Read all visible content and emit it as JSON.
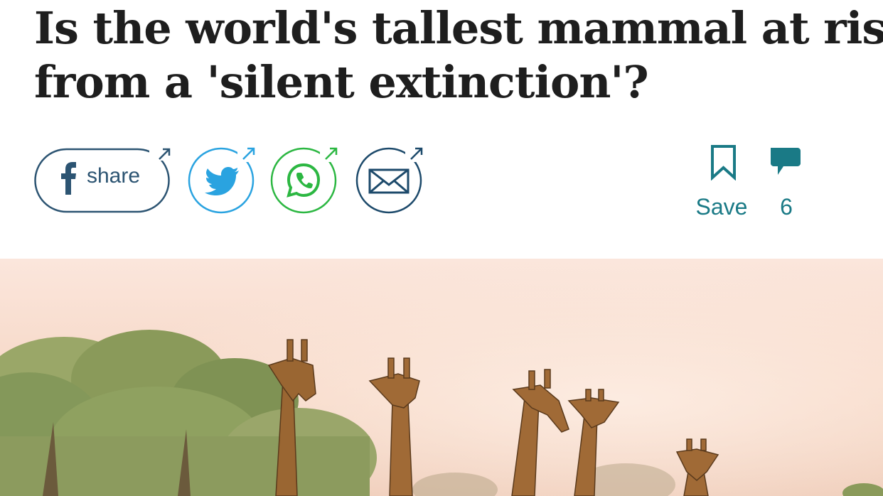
{
  "article": {
    "headline_line1": "Is the world's tallest mammal at risk",
    "headline_line2": "from a 'silent extinction'?"
  },
  "share": {
    "facebook_label": "share",
    "buttons": [
      "facebook",
      "twitter",
      "whatsapp",
      "email"
    ]
  },
  "actions": {
    "save_label": "Save",
    "comment_count": "6"
  },
  "hero_image": {
    "subject": "giraffes at dusk",
    "giraffe_count": 5
  },
  "colors": {
    "headline": "#1e1e1e",
    "facebook": "#2c5472",
    "twitter": "#2aa3e0",
    "whatsapp": "#2cb742",
    "email": "#1d4a6b",
    "action_teal": "#1a7a86",
    "sky": "#f9dccd"
  },
  "icons": [
    "facebook-icon",
    "twitter-icon",
    "whatsapp-icon",
    "email-icon",
    "bookmark-icon",
    "comment-icon",
    "external-arrow-icon"
  ]
}
